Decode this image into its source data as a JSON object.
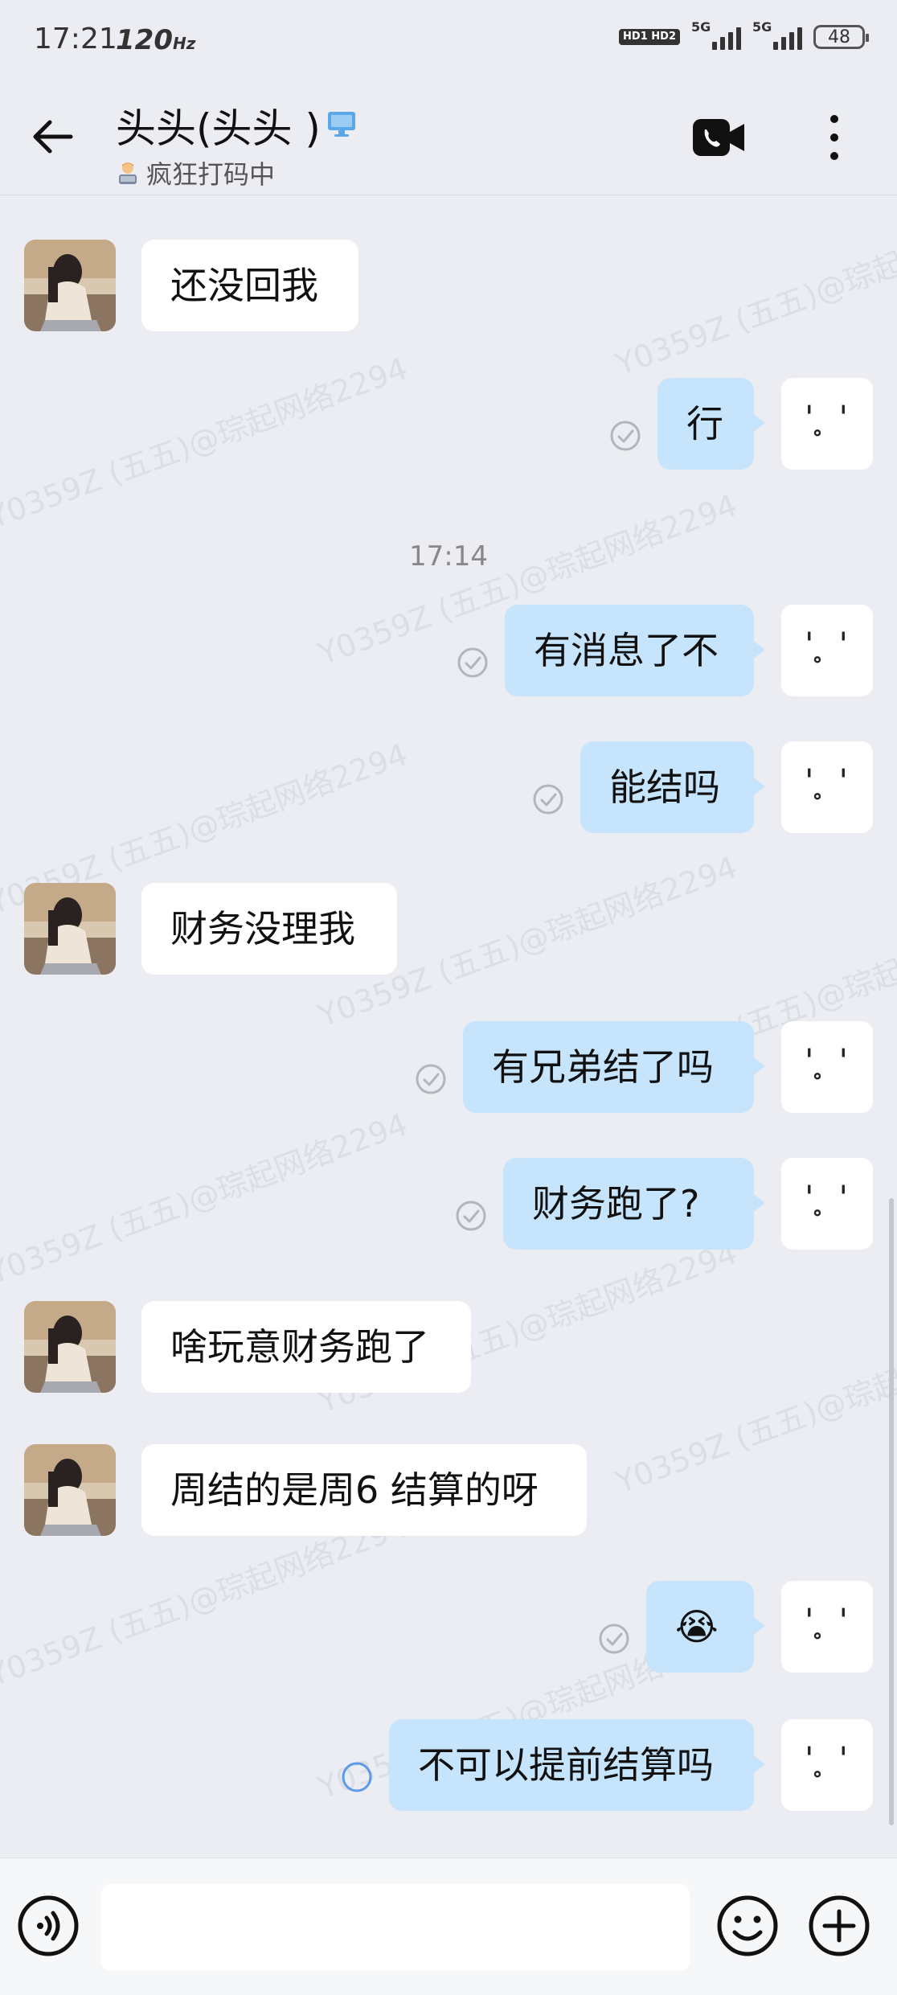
{
  "status_bar": {
    "time": "17:21",
    "refresh": "120",
    "refresh_unit": "Hz",
    "hd_badge": "HD1 HD2",
    "net1": "5G",
    "net2": "5G",
    "battery": "48"
  },
  "header": {
    "title": "头头(头头 )",
    "status": "疯狂打码中"
  },
  "watermark_text": "Y0359Z (五五)@琮起网络2294",
  "messages": [
    {
      "side": "in",
      "text": "还没回我"
    },
    {
      "side": "out",
      "text": "行",
      "state": "read"
    },
    {
      "side": "time",
      "text": "17:14"
    },
    {
      "side": "out",
      "text": "有消息了不",
      "state": "read"
    },
    {
      "side": "out",
      "text": "能结吗",
      "state": "read"
    },
    {
      "side": "in",
      "text": "财务没理我"
    },
    {
      "side": "out",
      "text": "有兄弟结了吗",
      "state": "read"
    },
    {
      "side": "out",
      "text": "财务跑了?",
      "state": "read"
    },
    {
      "side": "in",
      "text": "啥玩意财务跑了"
    },
    {
      "side": "in",
      "text": "周结的是周6 结算的呀"
    },
    {
      "side": "out",
      "text": "😭",
      "state": "read"
    },
    {
      "side": "out",
      "text": "不可以提前结算吗",
      "state": "sending"
    }
  ],
  "self_avatar_face": "' ̥ '",
  "input": {
    "value": "",
    "placeholder": ""
  },
  "icons": {
    "back": "arrow-left-icon",
    "device": "monitor-icon",
    "video": "video-call-icon",
    "more": "more-vertical-icon",
    "voice": "voice-icon",
    "emoji": "emoji-icon",
    "plus": "plus-icon"
  },
  "colors": {
    "background": "#ebedf2",
    "outgoing_bubble": "#c7e4fd",
    "incoming_bubble": "#ffffff",
    "accent": "#4a90e2"
  }
}
